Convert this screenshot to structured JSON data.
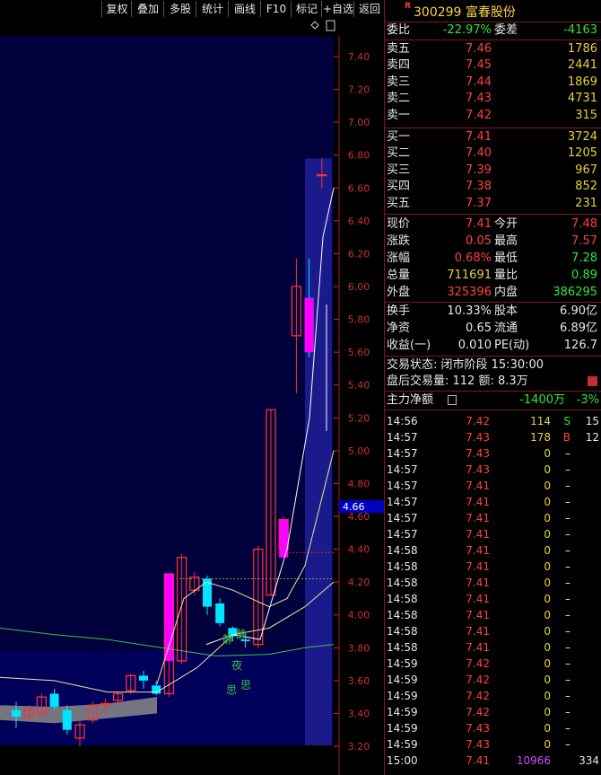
{
  "toolbar": {
    "buttons": [
      "复权",
      "叠加",
      "多股",
      "统计",
      "画线",
      "F10",
      "标记",
      "+自选",
      "返回"
    ]
  },
  "chart": {
    "price_ticks": [
      "7.40",
      "7.20",
      "7.00",
      "6.80",
      "6.60",
      "6.40",
      "6.20",
      "6.00",
      "5.80",
      "5.60",
      "5.40",
      "5.20",
      "5.00",
      "4.80",
      "4.60",
      "4.40",
      "4.20",
      "4.00",
      "3.80",
      "3.60",
      "3.40",
      "3.20"
    ],
    "current_price_tag": "4.66",
    "annotations": [
      "静",
      "静",
      "夜",
      "思",
      "思"
    ],
    "candles": [
      {
        "o": 3.42,
        "c": 3.38,
        "h": 3.47,
        "l": 3.31
      },
      {
        "o": 3.38,
        "c": 3.42,
        "h": 3.45,
        "l": 3.36
      },
      {
        "o": 3.4,
        "c": 3.5,
        "h": 3.52,
        "l": 3.38
      },
      {
        "o": 3.52,
        "c": 3.44,
        "h": 3.55,
        "l": 3.42
      },
      {
        "o": 3.42,
        "c": 3.3,
        "h": 3.45,
        "l": 3.27
      },
      {
        "o": 3.25,
        "c": 3.33,
        "h": 3.36,
        "l": 3.2
      },
      {
        "o": 3.36,
        "c": 3.45,
        "h": 3.47,
        "l": 3.34
      },
      {
        "o": 3.45,
        "c": 3.46,
        "h": 3.49,
        "l": 3.4
      },
      {
        "o": 3.48,
        "c": 3.52,
        "h": 3.53,
        "l": 3.46
      },
      {
        "o": 3.54,
        "c": 3.63,
        "h": 3.64,
        "l": 3.52
      },
      {
        "o": 3.63,
        "c": 3.6,
        "h": 3.66,
        "l": 3.55
      },
      {
        "o": 3.57,
        "c": 3.52,
        "h": 3.6,
        "l": 3.51
      },
      {
        "o": 3.52,
        "c": 4.25,
        "h": 4.25,
        "l": 3.5
      },
      {
        "o": 3.72,
        "c": 4.35,
        "h": 4.37,
        "l": 3.7
      },
      {
        "o": 4.15,
        "c": 4.23,
        "h": 4.26,
        "l": 4.12
      },
      {
        "o": 4.22,
        "c": 4.05,
        "h": 4.24,
        "l": 4.0
      },
      {
        "o": 4.07,
        "c": 3.95,
        "h": 4.1,
        "l": 3.93
      },
      {
        "o": 3.92,
        "c": 3.87,
        "h": 3.93,
        "l": 3.84
      },
      {
        "o": 3.85,
        "c": 3.84,
        "h": 3.88,
        "l": 3.8
      },
      {
        "o": 3.82,
        "c": 4.4,
        "h": 4.42,
        "l": 3.8
      },
      {
        "o": 4.12,
        "c": 5.25,
        "h": 5.25,
        "l": 4.12
      },
      {
        "o": 4.4,
        "c": 4.58,
        "h": 4.6,
        "l": 4.35
      },
      {
        "o": 5.7,
        "c": 6.0,
        "h": 6.17,
        "l": 5.35
      },
      {
        "o": 5.93,
        "c": 5.6,
        "h": 6.17,
        "l": 5.57
      },
      {
        "o": 6.68,
        "c": 6.68,
        "h": 6.78,
        "l": 6.6
      }
    ]
  },
  "stock": {
    "r_badge": "R",
    "code": "300299",
    "name": "富春股份"
  },
  "ratio": {
    "label1": "委比",
    "value1": "-22.97%",
    "label2": "委差",
    "value2": "-4163"
  },
  "sell": [
    {
      "label": "卖五",
      "price": "7.46",
      "vol": "1786"
    },
    {
      "label": "卖四",
      "price": "7.45",
      "vol": "2441"
    },
    {
      "label": "卖三",
      "price": "7.44",
      "vol": "1869"
    },
    {
      "label": "卖二",
      "price": "7.43",
      "vol": "4731"
    },
    {
      "label": "卖一",
      "price": "7.42",
      "vol": "315"
    }
  ],
  "buy": [
    {
      "label": "买一",
      "price": "7.41",
      "vol": "3724"
    },
    {
      "label": "买二",
      "price": "7.40",
      "vol": "1205"
    },
    {
      "label": "买三",
      "price": "7.39",
      "vol": "967"
    },
    {
      "label": "买四",
      "price": "7.38",
      "vol": "852"
    },
    {
      "label": "买五",
      "price": "7.37",
      "vol": "231"
    }
  ],
  "quote": [
    {
      "l1": "现价",
      "v1": "7.41",
      "c1": "red",
      "l2": "今开",
      "v2": "7.48",
      "c2": "red"
    },
    {
      "l1": "涨跌",
      "v1": "0.05",
      "c1": "red",
      "l2": "最高",
      "v2": "7.57",
      "c2": "red"
    },
    {
      "l1": "涨幅",
      "v1": "0.68%",
      "c1": "red",
      "l2": "最低",
      "v2": "7.28",
      "c2": "green"
    },
    {
      "l1": "总量",
      "v1": "711691",
      "c1": "yellow",
      "l2": "量比",
      "v2": "0.89",
      "c2": "green"
    },
    {
      "l1": "外盘",
      "v1": "325396",
      "c1": "red",
      "l2": "内盘",
      "v2": "386295",
      "c2": "green"
    }
  ],
  "fund": [
    {
      "l1": "换手",
      "v1": "10.33%",
      "l2": "股本",
      "v2": "6.90亿"
    },
    {
      "l1": "净资",
      "v1": "0.65",
      "l2": "流通",
      "v2": "6.89亿"
    },
    {
      "l1": "收益(一)",
      "v1": "0.010",
      "l2": "PE(动)",
      "v2": "126.7"
    }
  ],
  "status": {
    "line1": "交易状态: 闭市阶段 15:30:00",
    "line2": "盘后交易量: 112  额: 8.3万"
  },
  "main_flow": {
    "label": "主力净额",
    "value": "-1400万",
    "pct": "-3%"
  },
  "trades": [
    {
      "t": "14:56",
      "p": "7.42",
      "v": "114",
      "vc": "yellow",
      "f": "S",
      "fc": "green",
      "n": "15"
    },
    {
      "t": "14:57",
      "p": "7.43",
      "v": "178",
      "vc": "yellow",
      "f": "B",
      "fc": "red",
      "n": "12"
    },
    {
      "t": "14:57",
      "p": "7.43",
      "v": "0",
      "vc": "yellow",
      "f": "–",
      "fc": "white",
      "n": ""
    },
    {
      "t": "14:57",
      "p": "7.43",
      "v": "0",
      "vc": "yellow",
      "f": "–",
      "fc": "white",
      "n": ""
    },
    {
      "t": "14:57",
      "p": "7.41",
      "v": "0",
      "vc": "yellow",
      "f": "–",
      "fc": "white",
      "n": ""
    },
    {
      "t": "14:57",
      "p": "7.41",
      "v": "0",
      "vc": "yellow",
      "f": "–",
      "fc": "white",
      "n": ""
    },
    {
      "t": "14:57",
      "p": "7.41",
      "v": "0",
      "vc": "yellow",
      "f": "–",
      "fc": "white",
      "n": ""
    },
    {
      "t": "14:57",
      "p": "7.41",
      "v": "0",
      "vc": "yellow",
      "f": "–",
      "fc": "white",
      "n": ""
    },
    {
      "t": "14:58",
      "p": "7.41",
      "v": "0",
      "vc": "yellow",
      "f": "–",
      "fc": "white",
      "n": ""
    },
    {
      "t": "14:58",
      "p": "7.41",
      "v": "0",
      "vc": "yellow",
      "f": "–",
      "fc": "white",
      "n": ""
    },
    {
      "t": "14:58",
      "p": "7.41",
      "v": "0",
      "vc": "yellow",
      "f": "–",
      "fc": "white",
      "n": ""
    },
    {
      "t": "14:58",
      "p": "7.41",
      "v": "0",
      "vc": "yellow",
      "f": "–",
      "fc": "white",
      "n": ""
    },
    {
      "t": "14:58",
      "p": "7.41",
      "v": "0",
      "vc": "yellow",
      "f": "–",
      "fc": "white",
      "n": ""
    },
    {
      "t": "14:58",
      "p": "7.41",
      "v": "0",
      "vc": "yellow",
      "f": "–",
      "fc": "white",
      "n": ""
    },
    {
      "t": "14:58",
      "p": "7.41",
      "v": "0",
      "vc": "yellow",
      "f": "–",
      "fc": "white",
      "n": ""
    },
    {
      "t": "14:59",
      "p": "7.42",
      "v": "0",
      "vc": "yellow",
      "f": "–",
      "fc": "white",
      "n": ""
    },
    {
      "t": "14:59",
      "p": "7.42",
      "v": "0",
      "vc": "yellow",
      "f": "–",
      "fc": "white",
      "n": ""
    },
    {
      "t": "14:59",
      "p": "7.42",
      "v": "0",
      "vc": "yellow",
      "f": "–",
      "fc": "white",
      "n": ""
    },
    {
      "t": "14:59",
      "p": "7.42",
      "v": "0",
      "vc": "yellow",
      "f": "–",
      "fc": "white",
      "n": ""
    },
    {
      "t": "14:59",
      "p": "7.43",
      "v": "0",
      "vc": "yellow",
      "f": "–",
      "fc": "white",
      "n": ""
    },
    {
      "t": "14:59",
      "p": "7.43",
      "v": "0",
      "vc": "yellow",
      "f": "–",
      "fc": "white",
      "n": ""
    },
    {
      "t": "15:00",
      "p": "7.41",
      "v": "10966",
      "vc": "purple",
      "f": "",
      "fc": "white",
      "n": "334"
    }
  ],
  "colors": {
    "up": "#ff3030",
    "down": "#00e5ff",
    "bg_band": "#00005a",
    "ma_yellow": "#e8e8a0",
    "ma_green": "#3ec23e",
    "ma_white": "#ffffff"
  }
}
